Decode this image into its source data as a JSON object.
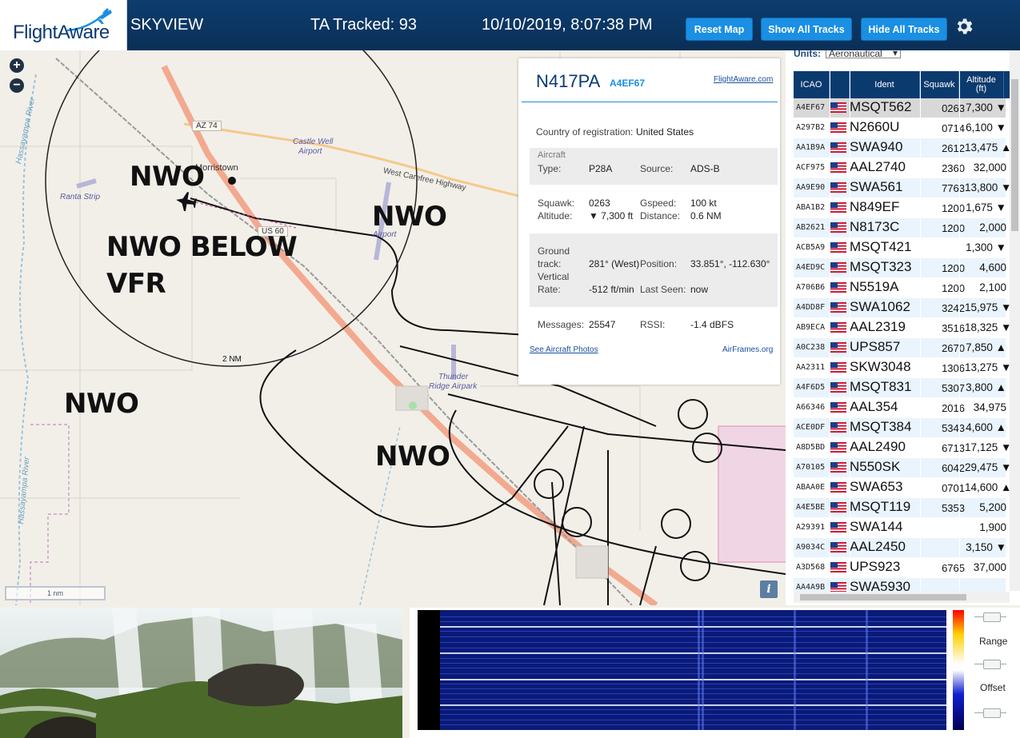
{
  "header": {
    "logo": "FlightAware",
    "app_name": "SKYVIEW",
    "tracked": "TA Tracked: 93",
    "datetime": "10/10/2019, 8:07:38 PM",
    "buttons": {
      "reset_map": "Reset Map",
      "show_all": "Show All Tracks",
      "hide_all": "Hide All Tracks"
    }
  },
  "map": {
    "zoom_in": "+",
    "zoom_out": "−",
    "annotations": [
      "NWO",
      "NWO",
      "NWO BELOW",
      "VFR",
      "NWO",
      "NWO"
    ],
    "labels": {
      "hwy_az74": "AZ 74",
      "hwy_us60": "US 60",
      "morristown": "Morristown",
      "castle_well": "Castle Well",
      "castle_well_2": "Airport",
      "ranta": "Ranta Strip",
      "airport": "Airport",
      "thunder": "Thunder",
      "thunder_2": "Ridge Airpark",
      "carefree": "West Carefree Highway",
      "hassayampa": "Hassayampa River",
      "range_ring": "2 NM"
    },
    "scale": "1 nm",
    "info": "i"
  },
  "popup": {
    "ident": "N417PA",
    "icao": "A4EF67",
    "fa_link": "FlightAware.com",
    "country_label": "Country of registration:",
    "country": "United States",
    "aircraft_label": "Aircraft",
    "type_label": "Type:",
    "type": "P28A",
    "source_label": "Source:",
    "source": "ADS-B",
    "squawk_label": "Squawk:",
    "squawk": "0263",
    "gspeed_label": "Gspeed:",
    "gspeed": "100 kt",
    "altitude_label": "Altitude:",
    "altitude": "▼ 7,300 ft",
    "distance_label": "Distance:",
    "distance": "0.6 NM",
    "ground_label": "Ground",
    "track_label": "track:",
    "track": "281° (West)",
    "position_label": "Position:",
    "position": "33.851°, -112.630°",
    "vertical_label": "Vertical",
    "rate_label": "Rate:",
    "rate": "-512 ft/min",
    "last_seen_label": "Last Seen:",
    "last_seen": "now",
    "messages_label": "Messages:",
    "messages": "25547",
    "rssi_label": "RSSI:",
    "rssi": "-1.4 dBFS",
    "photos_link": "See Aircraft Photos",
    "airframes_link": "AirFrames.org"
  },
  "table": {
    "units_label": "Units:",
    "units_value": "Aeronautical",
    "columns": {
      "icao": "ICAO",
      "ident": "Ident",
      "squawk": "Squawk",
      "altitude": "Altitude",
      "altitude_unit": "(ft)"
    },
    "rows": [
      {
        "icao": "A4EF67",
        "ident": "MSQT562",
        "squawk": "0263",
        "alt": "7,300 ▼"
      },
      {
        "icao": "A297B2",
        "ident": "N2660U",
        "squawk": "0714",
        "alt": "6,100 ▼"
      },
      {
        "icao": "AA1B9A",
        "ident": "SWA940",
        "squawk": "2612",
        "alt": "13,475 ▲"
      },
      {
        "icao": "ACF975",
        "ident": "AAL2740",
        "squawk": "2360",
        "alt": "32,000"
      },
      {
        "icao": "AA9E90",
        "ident": "SWA561",
        "squawk": "7763",
        "alt": "13,800 ▼"
      },
      {
        "icao": "ABA1B2",
        "ident": "N849EF",
        "squawk": "1200",
        "alt": "1,675 ▼"
      },
      {
        "icao": "AB2621",
        "ident": "N8173C",
        "squawk": "1200",
        "alt": "2,000"
      },
      {
        "icao": "ACB5A9",
        "ident": "MSQT421",
        "squawk": "",
        "alt": "1,300 ▼"
      },
      {
        "icao": "A4ED9C",
        "ident": "MSQT323",
        "squawk": "1200",
        "alt": "4,600"
      },
      {
        "icao": "A706B6",
        "ident": "N5519A",
        "squawk": "1200",
        "alt": "2,100"
      },
      {
        "icao": "A4DD8F",
        "ident": "SWA1062",
        "squawk": "3242",
        "alt": "15,975 ▼"
      },
      {
        "icao": "AB9ECA",
        "ident": "AAL2319",
        "squawk": "3516",
        "alt": "18,325 ▼"
      },
      {
        "icao": "A0C238",
        "ident": "UPS857",
        "squawk": "2670",
        "alt": "7,850 ▲"
      },
      {
        "icao": "AA2311",
        "ident": "SKW3048",
        "squawk": "1306",
        "alt": "13,275 ▼"
      },
      {
        "icao": "A4F6D5",
        "ident": "MSQT831",
        "squawk": "5307",
        "alt": "3,800 ▲"
      },
      {
        "icao": "A66346",
        "ident": "AAL354",
        "squawk": "2016",
        "alt": "34,975"
      },
      {
        "icao": "ACE0DF",
        "ident": "MSQT384",
        "squawk": "5343",
        "alt": "4,600 ▲"
      },
      {
        "icao": "A8D5BD",
        "ident": "AAL2490",
        "squawk": "6713",
        "alt": "17,125 ▼"
      },
      {
        "icao": "A70105",
        "ident": "N550SK",
        "squawk": "6042",
        "alt": "29,475 ▼"
      },
      {
        "icao": "ABAA0E",
        "ident": "SWA653",
        "squawk": "0701",
        "alt": "14,600 ▲"
      },
      {
        "icao": "A4E5BE",
        "ident": "MSQT119",
        "squawk": "5353",
        "alt": "5,200"
      },
      {
        "icao": "A29391",
        "ident": "SWA144",
        "squawk": "",
        "alt": "1,900"
      },
      {
        "icao": "A9034C",
        "ident": "AAL2450",
        "squawk": "",
        "alt": "3,150 ▼"
      },
      {
        "icao": "A3D568",
        "ident": "UPS923",
        "squawk": "6765",
        "alt": "37,000"
      },
      {
        "icao": "AA4A9B",
        "ident": "SWA5930",
        "squawk": "",
        "alt": ""
      }
    ]
  },
  "spectrum": {
    "range_label": "Range",
    "offset_label": "Offset"
  },
  "colors": {
    "header_bg": "#0a2f57",
    "accent": "#1a8fe3",
    "highway": "#f3a990",
    "route": "#000000"
  }
}
